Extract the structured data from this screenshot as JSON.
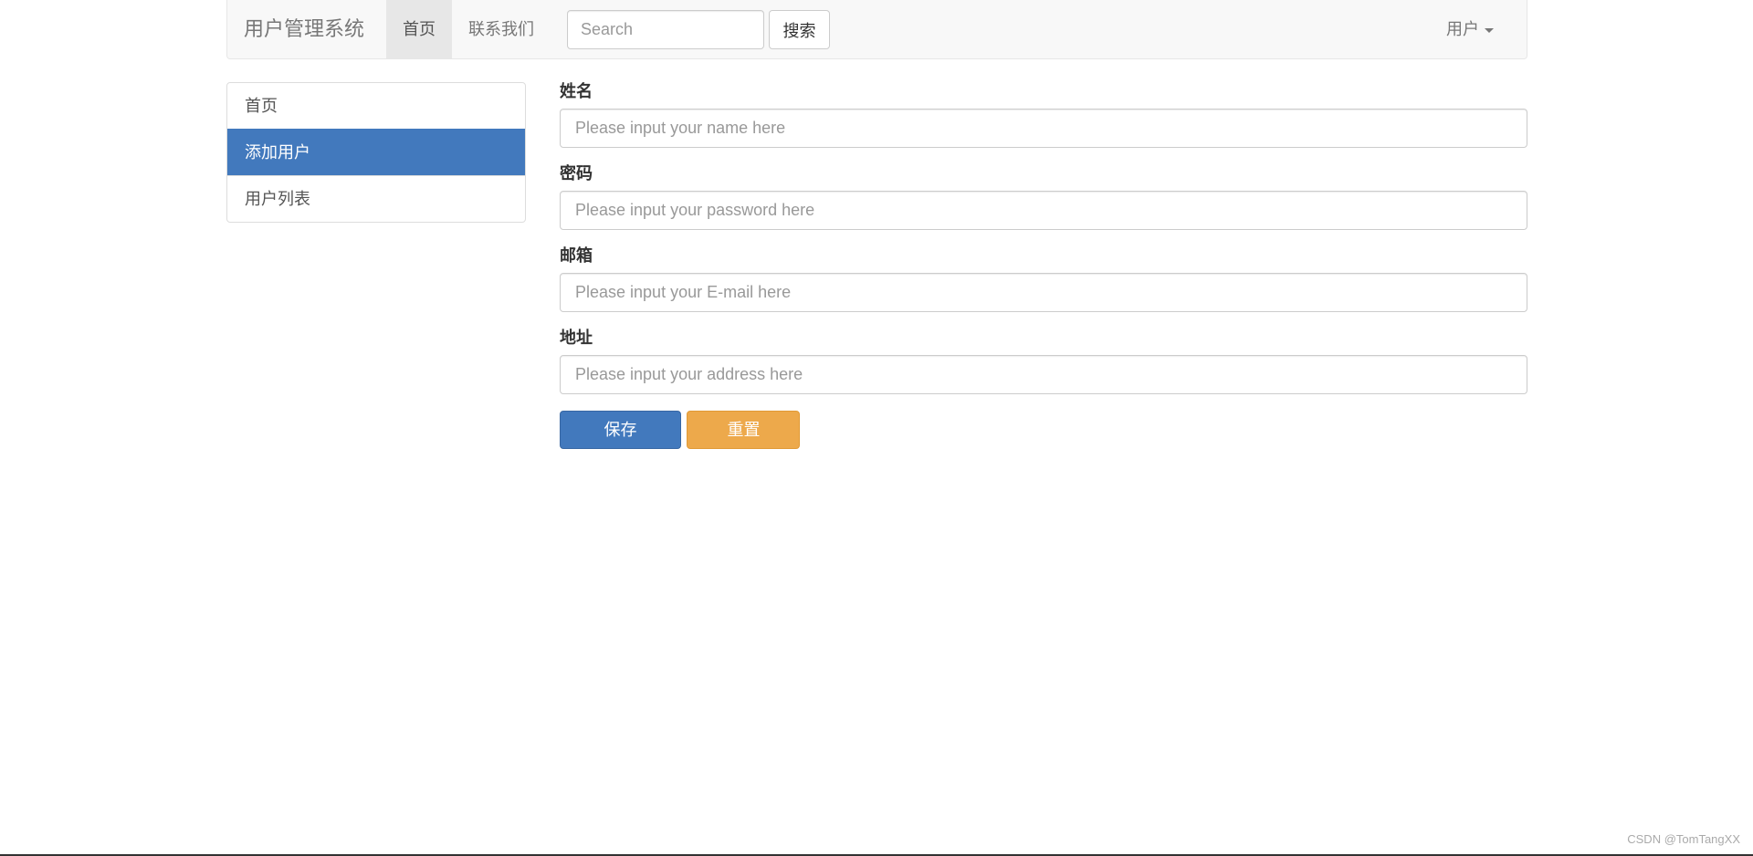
{
  "navbar": {
    "brand": "用户管理系统",
    "links": [
      {
        "label": "首页",
        "active": true
      },
      {
        "label": "联系我们",
        "active": false
      }
    ],
    "search": {
      "placeholder": "Search",
      "button_label": "搜索"
    },
    "user_menu": {
      "label": "用户",
      "icon": "caret-down-icon"
    }
  },
  "sidebar": {
    "items": [
      {
        "label": "首页",
        "active": false
      },
      {
        "label": "添加用户",
        "active": true
      },
      {
        "label": "用户列表",
        "active": false
      }
    ]
  },
  "form": {
    "fields": [
      {
        "label": "姓名",
        "placeholder": "Please input your name here",
        "value": ""
      },
      {
        "label": "密码",
        "placeholder": "Please input your password here",
        "value": ""
      },
      {
        "label": "邮箱",
        "placeholder": "Please input your E-mail here",
        "value": ""
      },
      {
        "label": "地址",
        "placeholder": "Please input your address here",
        "value": ""
      }
    ],
    "submit_label": "保存(Submit)",
    "reset_label": "重置(Reset)"
  },
  "watermark": "CSDN @TomTangXX",
  "colors": {
    "primary": "#4279bd",
    "warning": "#eda94b",
    "navbar_bg": "#f8f8f8"
  }
}
